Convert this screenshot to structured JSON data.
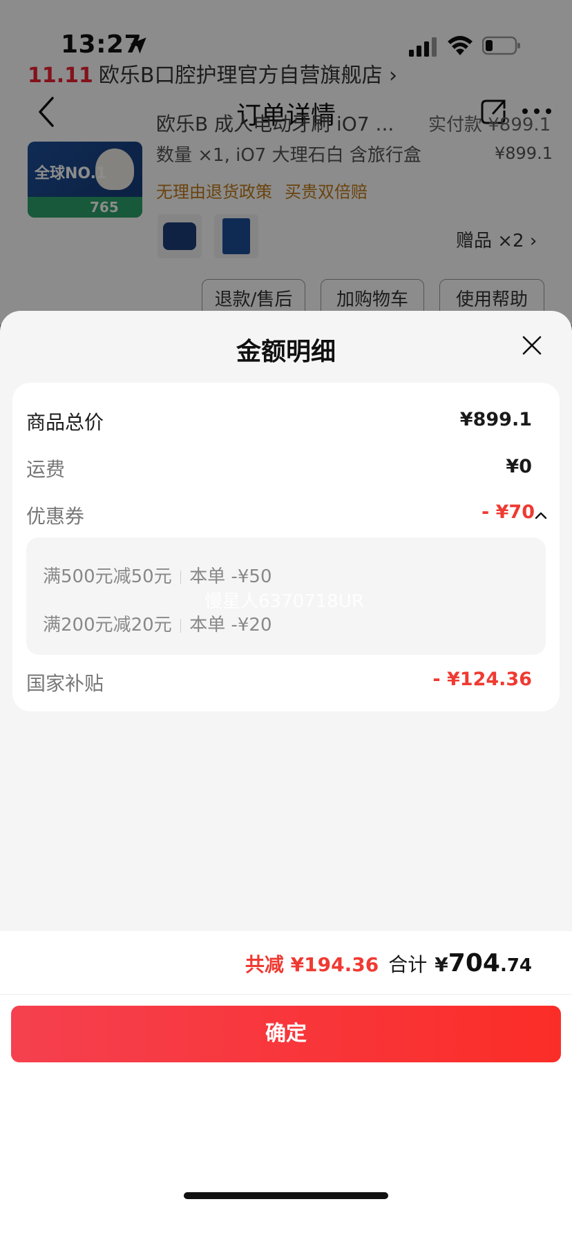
{
  "status_bar": {
    "time": "13:27"
  },
  "background": {
    "store": {
      "brand": "11.11",
      "name": "欧乐B口腔护理官方自营旗舰店 ›"
    },
    "nav": {
      "title": "订单详情"
    },
    "product": {
      "name": "欧乐B 成人电动牙刷 iO7 ...",
      "price_right": "实付款 ¥899.1",
      "spec": "数量 ×1, iO7 大理石白 含旅行盒",
      "unit_price": "¥899.1",
      "thumb_badge": "全球NO.1",
      "thumb_price": "765",
      "policies": [
        "无理由退货政策",
        "买贵双倍赔"
      ],
      "gift_label": "赠品 ×2 ›"
    },
    "actions": {
      "refund": "退款/售后",
      "cart": "加购物车",
      "help": "使用帮助"
    }
  },
  "sheet": {
    "title": "金额明细",
    "rows": {
      "total_label": "商品总价",
      "total_value": "¥899.1",
      "shipping_label": "运费",
      "shipping_value": "¥0",
      "coupon_label": "优惠券",
      "coupon_value": "- ¥70",
      "subsidy_label": "国家补贴",
      "subsidy_value": "- ¥124.36"
    },
    "coupons": [
      {
        "rule": "满500元减50元",
        "amount": "本单 -¥50"
      },
      {
        "rule": "满200元减20元",
        "amount": "本单 -¥20"
      }
    ],
    "watermark": "慢星人637071​8UR",
    "footer": {
      "saved": "共减 ¥194.36",
      "total_label": "合计",
      "total_currency": "¥",
      "total_int": "704",
      "total_dec": ".74"
    },
    "confirm_label": "确定"
  },
  "colors": {
    "accent_red": "#ef3a32",
    "confirm_gradient_start": "#f5404f",
    "confirm_gradient_end": "#fb2d28"
  }
}
